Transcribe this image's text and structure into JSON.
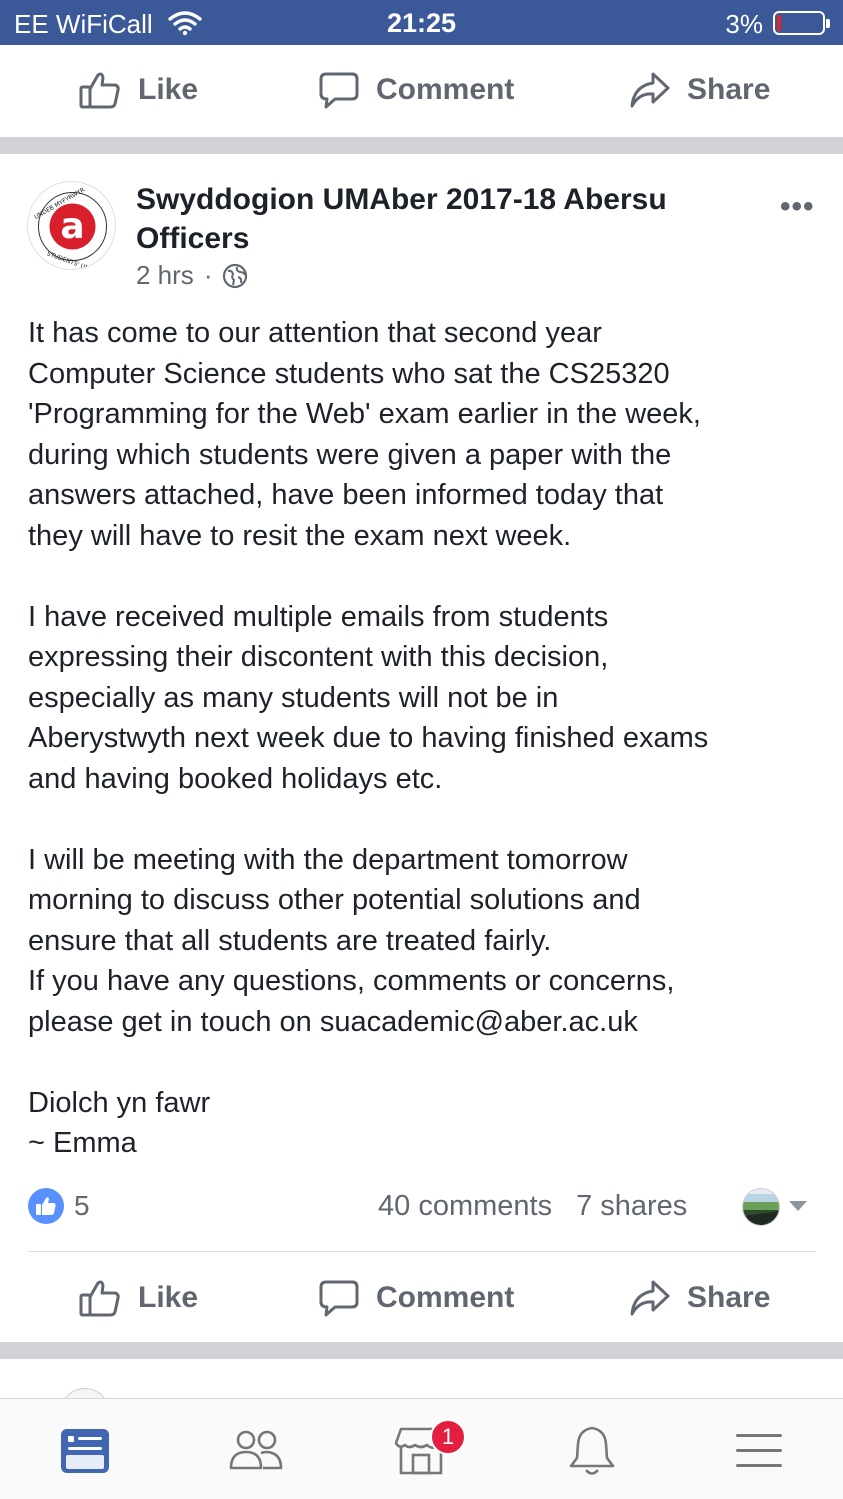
{
  "status_bar": {
    "carrier": "EE WiFiCall",
    "time": "21:25",
    "battery": "3%"
  },
  "top_actions": {
    "like": "Like",
    "comment": "Comment",
    "share": "Share"
  },
  "post": {
    "page_name": "Swyddogion UMAber 2017-18 Abersu Officers",
    "time_ago": "2 hrs",
    "separator": "·",
    "paragraphs": [
      "It has come to our attention that second year\nComputer Science students who sat the CS25320\n'Programming for the Web' exam earlier in the week,\nduring which students were given a paper with the\nanswers attached, have been informed today that\nthey will have to resit the exam next week.",
      "I have received multiple emails from students\nexpressing their discontent with this decision,\nespecially as many students will not be in\nAberystwyth next week due to having finished exams\nand having booked holidays etc.",
      "I will be meeting with the department tomorrow\nmorning to discuss other potential solutions and\nensure that all students are treated fairly.\nIf you have any questions, comments or concerns,\nplease get in touch on suacademic@aber.ac.uk",
      "Diolch yn fawr\n~ Emma"
    ],
    "reaction_count": "5",
    "comments": "40 comments",
    "shares": "7 shares",
    "avatar_logo": {
      "letter": "a",
      "ring_text_top": "UNDEB MYFYRWYR",
      "ring_text_bottom": "STUDENTS' UNION",
      "color": "#d7202b"
    }
  },
  "post_actions": {
    "like": "Like",
    "comment": "Comment",
    "share": "Share"
  },
  "tab_bar": {
    "items": [
      "news-feed-icon",
      "friends-icon",
      "marketplace-icon",
      "notifications-icon",
      "menu-icon"
    ],
    "marketplace_badge": "1"
  },
  "colors": {
    "brand": "#3b5998",
    "active_tab": "#4267b2",
    "like_badge": "#5890ff",
    "notification_badge": "#e41e3f",
    "muted_text": "#616770"
  }
}
